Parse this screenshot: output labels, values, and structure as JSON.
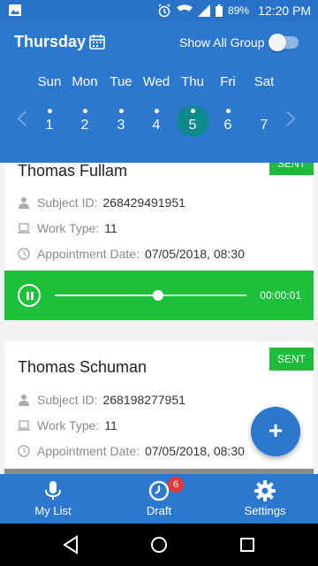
{
  "status_bar": {
    "battery": "89%",
    "time": "12:20 PM"
  },
  "header": {
    "day_title": "Thursday",
    "show_all_label": "Show All Group",
    "show_all_on": false,
    "weekdays": [
      "Sun",
      "Mon",
      "Tue",
      "Wed",
      "Thu",
      "Fri",
      "Sat"
    ],
    "dates": [
      "1",
      "2",
      "3",
      "4",
      "5",
      "6",
      "7"
    ],
    "selected_date": "5",
    "colors": {
      "primary": "#2c78cf",
      "selected": "#0e8a8c"
    }
  },
  "cards": [
    {
      "name": "Thomas Fullam",
      "status": "SENT",
      "subject_label": "Subject ID:",
      "subject_id": "268429491951",
      "work_label": "Work Type:",
      "work_type": "11",
      "appt_label": "Appointment Date:",
      "appt_date": "07/05/2018, 08:30"
    },
    {
      "name": "Thomas Schuman",
      "status": "SENT",
      "subject_label": "Subject ID:",
      "subject_id": "268198277951",
      "work_label": "Work Type:",
      "work_type": "11",
      "appt_label": "Appointment Date:",
      "appt_date": "07/05/2018, 08:30"
    }
  ],
  "player": {
    "elapsed": "00:00:01",
    "progress": 0.54,
    "state": "playing",
    "color": "#1dc03a"
  },
  "fab": {
    "label": "+"
  },
  "bottom_nav": {
    "items": [
      {
        "label": "My List",
        "icon": "microphone-icon",
        "active": true
      },
      {
        "label": "Draft",
        "icon": "clock-icon",
        "badge": "6"
      },
      {
        "label": "Settings",
        "icon": "gear-icon"
      }
    ]
  }
}
